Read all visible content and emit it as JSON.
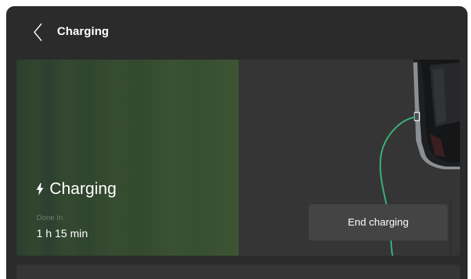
{
  "header": {
    "title": "Charging",
    "back_icon": "chevron-left-icon"
  },
  "charging_card": {
    "status_icon": "lightning-bolt-icon",
    "status_label": "Charging",
    "done_in_label": "Done In",
    "done_in_value": "1 h 15 min",
    "progress_fraction": 0.5,
    "end_button_label": "End charging",
    "cable_color": "#3bb27a",
    "progress_color": "#3a5232"
  }
}
